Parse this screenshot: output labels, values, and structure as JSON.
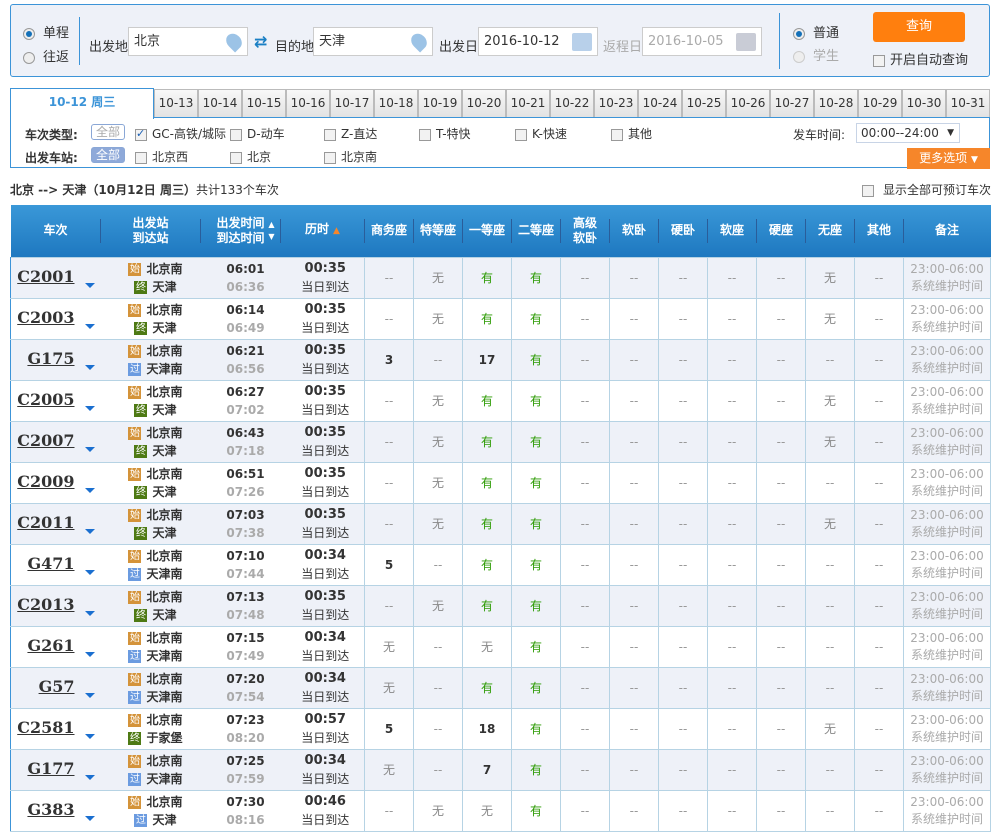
{
  "search": {
    "trip_types": [
      {
        "label": "单程",
        "selected": true
      },
      {
        "label": "往返",
        "selected": false
      }
    ],
    "from_label": "出发地",
    "from_value": "北京",
    "to_label": "目的地",
    "to_value": "天津",
    "depart_label": "出发日",
    "depart_value": "2016-10-12",
    "return_label": "返程日",
    "return_value": "2016-10-05",
    "passenger_types": [
      {
        "label": "普通",
        "selected": true
      },
      {
        "label": "学生",
        "selected": false
      }
    ],
    "query_button": "查询",
    "auto_query_label": "开启自动查询",
    "accent": "#ff7f0e"
  },
  "date_tabs": {
    "active": "10-12 周三",
    "dates": [
      "10-13",
      "10-14",
      "10-15",
      "10-16",
      "10-17",
      "10-18",
      "10-19",
      "10-20",
      "10-21",
      "10-22",
      "10-23",
      "10-24",
      "10-25",
      "10-26",
      "10-27",
      "10-28",
      "10-29",
      "10-30",
      "10-31"
    ]
  },
  "filters": {
    "type_label": "车次类型:",
    "all_label": "全部",
    "types": [
      {
        "label": "GC-高铁/城际",
        "checked": true
      },
      {
        "label": "D-动车",
        "checked": false
      },
      {
        "label": "Z-直达",
        "checked": false
      },
      {
        "label": "T-特快",
        "checked": false
      },
      {
        "label": "K-快速",
        "checked": false
      },
      {
        "label": "其他",
        "checked": false
      }
    ],
    "station_label": "出发车站:",
    "stations": [
      {
        "label": "北京西",
        "checked": false
      },
      {
        "label": "北京",
        "checked": false
      },
      {
        "label": "北京南",
        "checked": false
      }
    ],
    "time_label": "发车时间:",
    "time_value": "00:00--24:00",
    "more_label": "更多选项"
  },
  "summary": {
    "route": "北京 --> 天津（10月12日  周三）",
    "count_text": "共计133个车次",
    "show_all_label": "显示全部可预订车次"
  },
  "table": {
    "headers": [
      "车次",
      "出发站\n到达站",
      "出发时间\n到达时间",
      "历时",
      "商务座",
      "特等座",
      "一等座",
      "二等座",
      "高级\n软卧",
      "软卧",
      "硬卧",
      "软座",
      "硬座",
      "无座",
      "其他",
      "备注"
    ],
    "badge_colors": {
      "始": "#d4933a",
      "终": "#4e7a14",
      "过": "#6b9be0"
    },
    "rows": [
      {
        "train": "C2001",
        "from": "北京南",
        "from_badge": "始",
        "to": "天津",
        "to_badge": "终",
        "dep": "06:01",
        "arr": "06:36",
        "dur": "00:35",
        "day": "当日到达",
        "seats": [
          "--",
          "无",
          "有",
          "有",
          "--",
          "--",
          "--",
          "--",
          "--",
          "无",
          "--"
        ],
        "remark": "23:00-06:00系统维护时间"
      },
      {
        "train": "C2003",
        "from": "北京南",
        "from_badge": "始",
        "to": "天津",
        "to_badge": "终",
        "dep": "06:14",
        "arr": "06:49",
        "dur": "00:35",
        "day": "当日到达",
        "seats": [
          "--",
          "无",
          "有",
          "有",
          "--",
          "--",
          "--",
          "--",
          "--",
          "无",
          "--"
        ],
        "remark": "23:00-06:00系统维护时间"
      },
      {
        "train": "G175",
        "from": "北京南",
        "from_badge": "始",
        "to": "天津南",
        "to_badge": "过",
        "dep": "06:21",
        "arr": "06:56",
        "dur": "00:35",
        "day": "当日到达",
        "seats": [
          "3",
          "--",
          "17",
          "有",
          "--",
          "--",
          "--",
          "--",
          "--",
          "--",
          "--"
        ],
        "remark": "23:00-06:00系统维护时间"
      },
      {
        "train": "C2005",
        "from": "北京南",
        "from_badge": "始",
        "to": "天津",
        "to_badge": "终",
        "dep": "06:27",
        "arr": "07:02",
        "dur": "00:35",
        "day": "当日到达",
        "seats": [
          "--",
          "无",
          "有",
          "有",
          "--",
          "--",
          "--",
          "--",
          "--",
          "无",
          "--"
        ],
        "remark": "23:00-06:00系统维护时间"
      },
      {
        "train": "C2007",
        "from": "北京南",
        "from_badge": "始",
        "to": "天津",
        "to_badge": "终",
        "dep": "06:43",
        "arr": "07:18",
        "dur": "00:35",
        "day": "当日到达",
        "seats": [
          "--",
          "无",
          "有",
          "有",
          "--",
          "--",
          "--",
          "--",
          "--",
          "无",
          "--"
        ],
        "remark": "23:00-06:00系统维护时间"
      },
      {
        "train": "C2009",
        "from": "北京南",
        "from_badge": "始",
        "to": "天津",
        "to_badge": "终",
        "dep": "06:51",
        "arr": "07:26",
        "dur": "00:35",
        "day": "当日到达",
        "seats": [
          "--",
          "无",
          "有",
          "有",
          "--",
          "--",
          "--",
          "--",
          "--",
          "--",
          "--"
        ],
        "remark": "23:00-06:00系统维护时间"
      },
      {
        "train": "C2011",
        "from": "北京南",
        "from_badge": "始",
        "to": "天津",
        "to_badge": "终",
        "dep": "07:03",
        "arr": "07:38",
        "dur": "00:35",
        "day": "当日到达",
        "seats": [
          "--",
          "无",
          "有",
          "有",
          "--",
          "--",
          "--",
          "--",
          "--",
          "无",
          "--"
        ],
        "remark": "23:00-06:00系统维护时间"
      },
      {
        "train": "G471",
        "from": "北京南",
        "from_badge": "始",
        "to": "天津南",
        "to_badge": "过",
        "dep": "07:10",
        "arr": "07:44",
        "dur": "00:34",
        "day": "当日到达",
        "seats": [
          "5",
          "--",
          "有",
          "有",
          "--",
          "--",
          "--",
          "--",
          "--",
          "--",
          "--"
        ],
        "remark": "23:00-06:00系统维护时间"
      },
      {
        "train": "C2013",
        "from": "北京南",
        "from_badge": "始",
        "to": "天津",
        "to_badge": "终",
        "dep": "07:13",
        "arr": "07:48",
        "dur": "00:35",
        "day": "当日到达",
        "seats": [
          "--",
          "无",
          "有",
          "有",
          "--",
          "--",
          "--",
          "--",
          "--",
          "--",
          "--"
        ],
        "remark": "23:00-06:00系统维护时间"
      },
      {
        "train": "G261",
        "from": "北京南",
        "from_badge": "始",
        "to": "天津南",
        "to_badge": "过",
        "dep": "07:15",
        "arr": "07:49",
        "dur": "00:34",
        "day": "当日到达",
        "seats": [
          "无",
          "--",
          "无",
          "有",
          "--",
          "--",
          "--",
          "--",
          "--",
          "--",
          "--"
        ],
        "remark": "23:00-06:00系统维护时间"
      },
      {
        "train": "G57",
        "from": "北京南",
        "from_badge": "始",
        "to": "天津南",
        "to_badge": "过",
        "dep": "07:20",
        "arr": "07:54",
        "dur": "00:34",
        "day": "当日到达",
        "seats": [
          "无",
          "--",
          "有",
          "有",
          "--",
          "--",
          "--",
          "--",
          "--",
          "--",
          "--"
        ],
        "remark": "23:00-06:00系统维护时间"
      },
      {
        "train": "C2581",
        "from": "北京南",
        "from_badge": "始",
        "to": "于家堡",
        "to_badge": "终",
        "dep": "07:23",
        "arr": "08:20",
        "dur": "00:57",
        "day": "当日到达",
        "seats": [
          "5",
          "--",
          "18",
          "有",
          "--",
          "--",
          "--",
          "--",
          "--",
          "无",
          "--"
        ],
        "remark": "23:00-06:00系统维护时间"
      },
      {
        "train": "G177",
        "from": "北京南",
        "from_badge": "始",
        "to": "天津南",
        "to_badge": "过",
        "dep": "07:25",
        "arr": "07:59",
        "dur": "00:34",
        "day": "当日到达",
        "seats": [
          "无",
          "--",
          "7",
          "有",
          "--",
          "--",
          "--",
          "--",
          "--",
          "--",
          "--"
        ],
        "remark": "23:00-06:00系统维护时间"
      },
      {
        "train": "G383",
        "from": "北京南",
        "from_badge": "始",
        "to": "天津",
        "to_badge": "过",
        "dep": "07:30",
        "arr": "08:16",
        "dur": "00:46",
        "day": "当日到达",
        "seats": [
          "--",
          "无",
          "无",
          "有",
          "--",
          "--",
          "--",
          "--",
          "--",
          "--",
          "--"
        ],
        "remark": "23:00-06:00系统维护时间"
      }
    ]
  }
}
